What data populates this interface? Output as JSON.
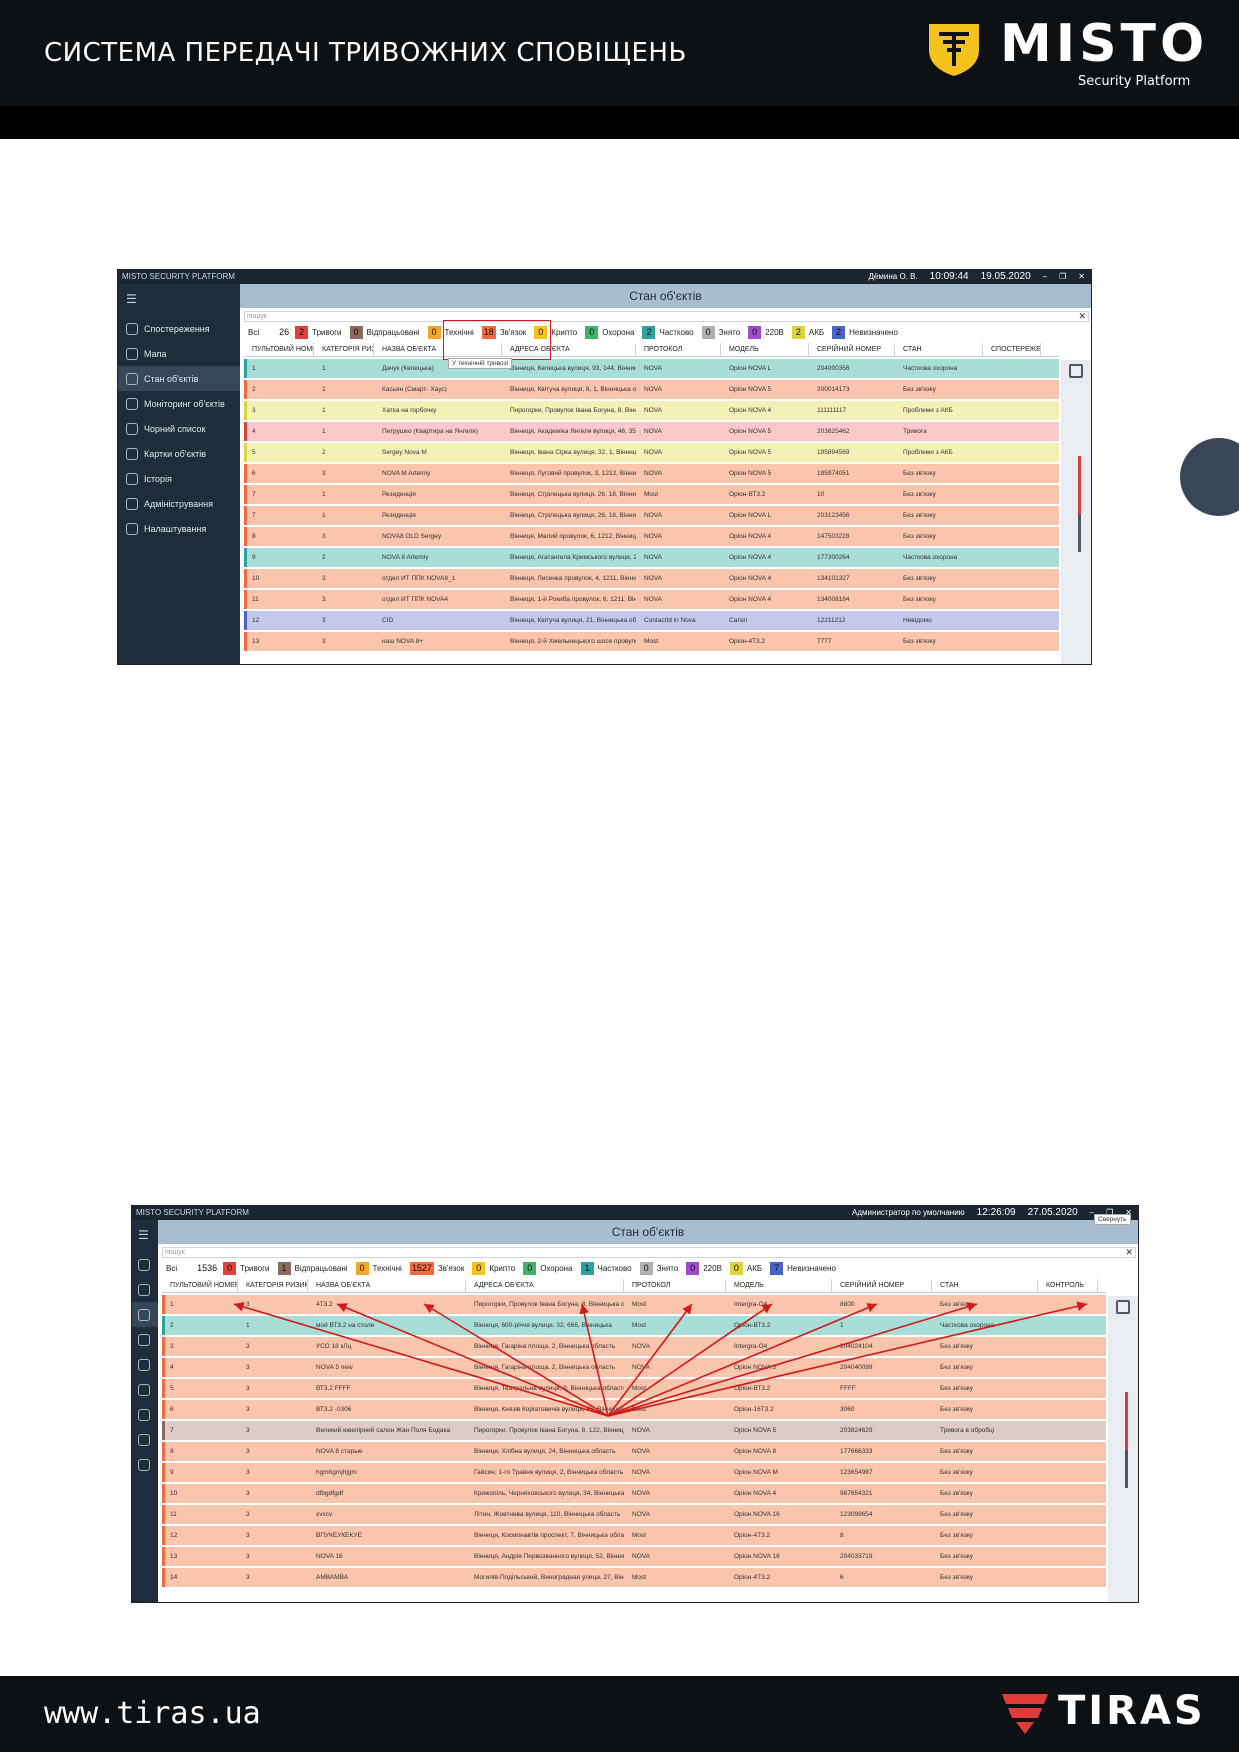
{
  "header": {
    "title": "СИСТЕМА ПЕРЕДАЧІ ТРИВОЖНИХ СПОВІЩЕНЬ",
    "logo_text": "MISTO",
    "logo_sub": "Security Platform"
  },
  "footer": {
    "url": "www.tiras.ua",
    "logo_text": "TIRAS"
  },
  "shot1": {
    "app_title": "MISTO SECURITY PLATFORM",
    "user": "Дёмина О. В.",
    "time": "10:09:44",
    "date": "19.05.2020",
    "page_title": "Стан об'єктів",
    "search_placeholder": "пошук",
    "tooltip": "У технічній тривозі",
    "sidebar": [
      "Спостереження",
      "Мапа",
      "Стан об'єктів",
      "Моніторинг об'єктів",
      "Чорний список",
      "Картки об'єктів",
      "Історія",
      "Адміністрування",
      "Налаштування"
    ],
    "filters": [
      {
        "label": "Всі",
        "count": "26",
        "color": "#ffffff"
      },
      {
        "label": "Тривоги",
        "count": "2",
        "color": "#e0413f"
      },
      {
        "label": "Відпрацьовані",
        "count": "0",
        "color": "#8a6a5d"
      },
      {
        "label": "Технічні",
        "count": "0",
        "color": "#f4a62a"
      },
      {
        "label": "Зв'язок",
        "count": "18",
        "color": "#f46a3c"
      },
      {
        "label": "Крипто",
        "count": "0",
        "color": "#f6c21c"
      },
      {
        "label": "Охорона",
        "count": "0",
        "color": "#43b36b"
      },
      {
        "label": "Частково",
        "count": "2",
        "color": "#2aa3a0"
      },
      {
        "label": "Знято",
        "count": "0",
        "color": "#b0b0b0"
      },
      {
        "label": "220В",
        "count": "0",
        "color": "#a04ad0"
      },
      {
        "label": "АКБ",
        "count": "2",
        "color": "#d9d53a"
      },
      {
        "label": "Невизначено",
        "count": "2",
        "color": "#4a63c4"
      }
    ],
    "columns": [
      "ПУЛЬТОВИЙ НОМЕР ↑",
      "КАТЕГОРІЯ РИЗИКУ",
      "НАЗВА ОБ'ЄКТА",
      "АДРЕСА ОБ'ЄКТА",
      "ПРОТОКОЛ",
      "МОДЕЛЬ",
      "СЕРІЙНИЙ НОМЕР",
      "СТАН",
      "СПОСТЕРЕЖЕННЯ"
    ],
    "rows": [
      {
        "n": "1",
        "cat": "1",
        "name": "Дачук (Келецька)",
        "addr": "Вінниця, Келецька вулиця, 93, 144, Вінницька обл",
        "proto": "NOVA",
        "model": "Оріон NOVA L",
        "serial": "204000356",
        "state": "Часткова охорона",
        "bg": "#a8ddd8",
        "bar": "#2aa3a0"
      },
      {
        "n": "2",
        "cat": "1",
        "name": "Касьян (Смарт- Хаус)",
        "addr": "Вінниця, Квітуча вулиця, 8, 1, Вінницька обл",
        "proto": "NOVA",
        "model": "Оріон NOVA 5",
        "serial": "200014173",
        "state": "Без зв'язку",
        "bg": "#fbc4ad",
        "bar": "#f46a3c"
      },
      {
        "n": "3",
        "cat": "1",
        "name": "Хатка на горбочку",
        "addr": "Пирогорки, Провулок Івана Богуна, 8, Вінницьк",
        "proto": "NOVA",
        "model": "Оріон NOVA 4",
        "serial": "111111117",
        "state": "Проблеми з АКБ",
        "bg": "#f3f1b6",
        "bar": "#d9d53a"
      },
      {
        "n": "4",
        "cat": "1",
        "name": "Петрушко (Квартира на Янгеля)",
        "addr": "Вінниця, Академіка Янгеля вулиця, 46, 35, Ві",
        "proto": "NOVA",
        "model": "Оріон NOVA 5",
        "serial": "203825462",
        "state": "Тривога",
        "bg": "#fbc8cb",
        "bar": "#e0413f"
      },
      {
        "n": "5",
        "cat": "2",
        "name": "Sergey Nova M",
        "addr": "Вінниця, Івана Сірка вулиця, 32, 1, Вінницька обл",
        "proto": "NOVA",
        "model": "Оріон NOVA 5",
        "serial": "195894569",
        "state": "Проблеми з АКБ",
        "bg": "#f3f1b6",
        "bar": "#d9d53a"
      },
      {
        "n": "6",
        "cat": "3",
        "name": "NOVA M Artemiy",
        "addr": "Вінниця, Луговий провулок, 3, 1212, Вінницька",
        "proto": "NOVA",
        "model": "Оріон NOVA 5",
        "serial": "195974051",
        "state": "Без зв'язку",
        "bg": "#fbc4ad",
        "bar": "#f46a3c"
      },
      {
        "n": "7",
        "cat": "1",
        "name": "Резиденція",
        "addr": "Вінниця, Стрілецька вулиця, 26, 18, Вінницька",
        "proto": "Most",
        "model": "Оріон-ВТ3.2",
        "serial": "10",
        "state": "Без зв'язку",
        "bg": "#fbc4ad",
        "bar": "#f46a3c"
      },
      {
        "n": "7",
        "cat": "1",
        "name": "Резиденція",
        "addr": "Вінниця, Стрілецька вулиця, 26, 18, Вінницька",
        "proto": "NOVA",
        "model": "Оріон NOVA L",
        "serial": "203123456",
        "state": "Без зв'язку",
        "bg": "#fbc4ad",
        "bar": "#f46a3c"
      },
      {
        "n": "8",
        "cat": "3",
        "name": "NOVA8 OLD Sergey",
        "addr": "Вінниця, Малий провулок, 6, 1212, Вінницька",
        "proto": "NOVA",
        "model": "Оріон NOVA 4",
        "serial": "147503228",
        "state": "Без зв'язку",
        "bg": "#fbc4ad",
        "bar": "#f46a3c"
      },
      {
        "n": "9",
        "cat": "2",
        "name": "NOVA 8 Artemiy",
        "addr": "Вінниця, Агатангела Кримського вулиця, 26,",
        "proto": "NOVA",
        "model": "Оріон NOVA 4",
        "serial": "177300264",
        "state": "Часткова охорона",
        "bg": "#a8ddd8",
        "bar": "#2aa3a0"
      },
      {
        "n": "10",
        "cat": "3",
        "name": "отдел ИТ ППК NOVA8_1",
        "addr": "Вінниця, Лисенка провулок, 4, 1211, Вінницька",
        "proto": "NOVA",
        "model": "Оріон NOVA 4",
        "serial": "134101327",
        "state": "Без зв'язку",
        "bg": "#fbc4ad",
        "bar": "#f46a3c"
      },
      {
        "n": "11",
        "cat": "3",
        "name": "отдел ИТ ППК NOVA4",
        "addr": "Вінниця, 1-й Рокиба провулок, 6, 1211, Він",
        "proto": "NOVA",
        "model": "Оріон NOVA 4",
        "serial": "134008184",
        "state": "Без зв'язку",
        "bg": "#fbc4ad",
        "bar": "#f46a3c"
      },
      {
        "n": "12",
        "cat": "3",
        "name": "CID",
        "addr": "Вінниця, Квітуча вулиця, 21, Вінницька обл",
        "proto": "ContactId in Nova",
        "model": "Сател",
        "serial": "12211212",
        "state": "Невідомо",
        "bg": "#c3c8ec",
        "bar": "#4a63c4"
      },
      {
        "n": "13",
        "cat": "3",
        "name": "наш NOVA 8+",
        "addr": "Вінниця, 2-й Хмельницького шосе провулок",
        "proto": "Most",
        "model": "Оріон-4Т3.2",
        "serial": "7777",
        "state": "Без зв'язку",
        "bg": "#fbc4ad",
        "bar": "#f46a3c"
      }
    ]
  },
  "shot2": {
    "app_title": "MISTO SECURITY PLATFORM",
    "user": "Администратор по умолчанию",
    "time": "12:26:09",
    "date": "27.05.2020",
    "minimize_tooltip": "Свернуть",
    "page_title": "Стан об'єктів",
    "search_placeholder": "пошук",
    "filters": [
      {
        "label": "Всі",
        "count": "1536",
        "color": "#ffffff"
      },
      {
        "label": "Тривоги",
        "count": "0",
        "color": "#e0413f"
      },
      {
        "label": "Відпрацьовані",
        "count": "1",
        "color": "#8a6a5d"
      },
      {
        "label": "Технічні",
        "count": "0",
        "color": "#f4a62a"
      },
      {
        "label": "Зв'язок",
        "count": "1527",
        "color": "#f46a3c"
      },
      {
        "label": "Крипто",
        "count": "0",
        "color": "#f6c21c"
      },
      {
        "label": "Охорона",
        "count": "0",
        "color": "#43b36b"
      },
      {
        "label": "Частково",
        "count": "1",
        "color": "#2aa3a0"
      },
      {
        "label": "Знято",
        "count": "0",
        "color": "#b0b0b0"
      },
      {
        "label": "220В",
        "count": "0",
        "color": "#a04ad0"
      },
      {
        "label": "АКБ",
        "count": "0",
        "color": "#d9d53a"
      },
      {
        "label": "Невизначено",
        "count": "7",
        "color": "#4a63c4"
      }
    ],
    "columns": [
      "ПУЛЬТОВИЙ НОМЕР ↑",
      "КАТЕГОРІЯ РИЗИКУ",
      "НАЗВА ОБ'ЄКТА",
      "АДРЕСА ОБ'ЄКТА",
      "ПРОТОКОЛ",
      "МОДЕЛЬ",
      "СЕРІЙНИЙ НОМЕР",
      "СТАН",
      "КОНТРОЛЬ"
    ],
    "rows": [
      {
        "n": "1",
        "cat": "3",
        "name": "4Т3.2",
        "addr": "Пирогорки, Провулок Івана Богуна, 8, Вінницька обл",
        "proto": "Most",
        "model": "Intergra-O4",
        "serial": "8800",
        "state": "Без зв'язку",
        "bg": "#fbc4ad",
        "bar": "#f46a3c"
      },
      {
        "n": "2",
        "cat": "1",
        "name": "мой ВТ3.2 на столе",
        "addr": "Вінниця, 600-річчя вулиця, 32, 666, Вінницька",
        "proto": "Most",
        "model": "Оріон-ВТ3.2",
        "serial": "1",
        "state": "Часткова охорона",
        "bg": "#a8ddd8",
        "bar": "#2aa3a0"
      },
      {
        "n": "3",
        "cat": "3",
        "name": "УСО 18 кЛц",
        "addr": "Вінниця, Гагаріна площа, 2, Вінницька область",
        "proto": "NOVA",
        "model": "Intergra-O4",
        "serial": "204024104",
        "state": "Без зв'язку",
        "bg": "#fbc4ad",
        "bar": "#f46a3c"
      },
      {
        "n": "4",
        "cat": "3",
        "name": "NOVA 5 new",
        "addr": "Вінниця, Гагаріна площа, 2, Вінницька область",
        "proto": "NOVA",
        "model": "Оріон NOVA 5",
        "serial": "204040099",
        "state": "Без зв'язку",
        "bg": "#fbc4ad",
        "bar": "#f46a3c"
      },
      {
        "n": "5",
        "cat": "3",
        "name": "ВТ3.2 FFFF",
        "addr": "Вінниця, Театральна вулиця, 9, Вінницька область",
        "proto": "Most",
        "model": "Оріон-ВТ3.2",
        "serial": "FFFF",
        "state": "Без зв'язку",
        "bg": "#fbc4ad",
        "bar": "#f46a3c"
      },
      {
        "n": "6",
        "cat": "3",
        "name": "ВТ3.2 -0306",
        "addr": "Вінниця, Князів Коріатовичів вулиця, 85, Вінницька",
        "proto": "Most",
        "model": "Оріон-16Т3.2",
        "serial": "3060",
        "state": "Без зв'язку",
        "bg": "#fbc4ad",
        "bar": "#f46a3c"
      },
      {
        "n": "7",
        "cat": "3",
        "name": "Великий ювелірний салон Жан Поля Бодака",
        "addr": "Пирогорки, Провулок Івана Богуна, 8, 122, Вінницька",
        "proto": "NOVA",
        "model": "Оріон NOVA 5",
        "serial": "203824629",
        "state": "Тривога в обробці",
        "bg": "#dccbc6",
        "bar": "#8a6a5d"
      },
      {
        "n": "8",
        "cat": "3",
        "name": "NOVA 8 старые",
        "addr": "Вінниця, Хлібна вулиця, 24, Вінницька область",
        "proto": "NOVA",
        "model": "Оріон NOVA 8",
        "serial": "177666333",
        "state": "Без зв'язку",
        "bg": "#fbc4ad",
        "bar": "#f46a3c"
      },
      {
        "n": "9",
        "cat": "3",
        "name": "hgmhgmjhjgm",
        "addr": "Гайсин, 1-го Травня вулиця, 2, Вінницька область",
        "proto": "NOVA",
        "model": "Оріон NOVA M",
        "serial": "123654987",
        "state": "Без зв'язку",
        "bg": "#fbc4ad",
        "bar": "#f46a3c"
      },
      {
        "n": "10",
        "cat": "3",
        "name": "dfbgdfgdf",
        "addr": "Крижопіль, Черняховського вулиця, 34, Вінницька",
        "proto": "NOVA",
        "model": "Оріон NOVA 4",
        "serial": "987654321",
        "state": "Без зв'язку",
        "bg": "#fbc4ad",
        "bar": "#f46a3c"
      },
      {
        "n": "11",
        "cat": "3",
        "name": "xvxcv",
        "addr": "Літин, Жовтнева вулиця, 110, Вінницька область",
        "proto": "NOVA",
        "model": "Оріон NOVA 16",
        "serial": "123098654",
        "state": "Без зв'язку",
        "bg": "#fbc4ad",
        "bar": "#f46a3c"
      },
      {
        "n": "12",
        "cat": "3",
        "name": "ВПУКЕУКЕКУЕ",
        "addr": "Вінниця, Космонавтів проспект, 7, Вінницька облас",
        "proto": "Most",
        "model": "Оріон-4Т3.2",
        "serial": "8",
        "state": "Без зв'язку",
        "bg": "#fbc4ad",
        "bar": "#f46a3c"
      },
      {
        "n": "13",
        "cat": "3",
        "name": "NOVA 16",
        "addr": "Вінниця, Андрія Первозванного вулиця, 52, Вінниця",
        "proto": "NOVA",
        "model": "Оріон NOVA 16",
        "serial": "204033719",
        "state": "Без зв'язку",
        "bg": "#fbc4ad",
        "bar": "#f46a3c"
      },
      {
        "n": "14",
        "cat": "3",
        "name": "АМВАМВА",
        "addr": "Могилів-Подільський, Виноградная улица, 27, Вінн",
        "proto": "Most",
        "model": "Оріон-4Т3.2",
        "serial": "6",
        "state": "Без зв'язку",
        "bg": "#fbc4ad",
        "bar": "#f46a3c"
      }
    ]
  }
}
